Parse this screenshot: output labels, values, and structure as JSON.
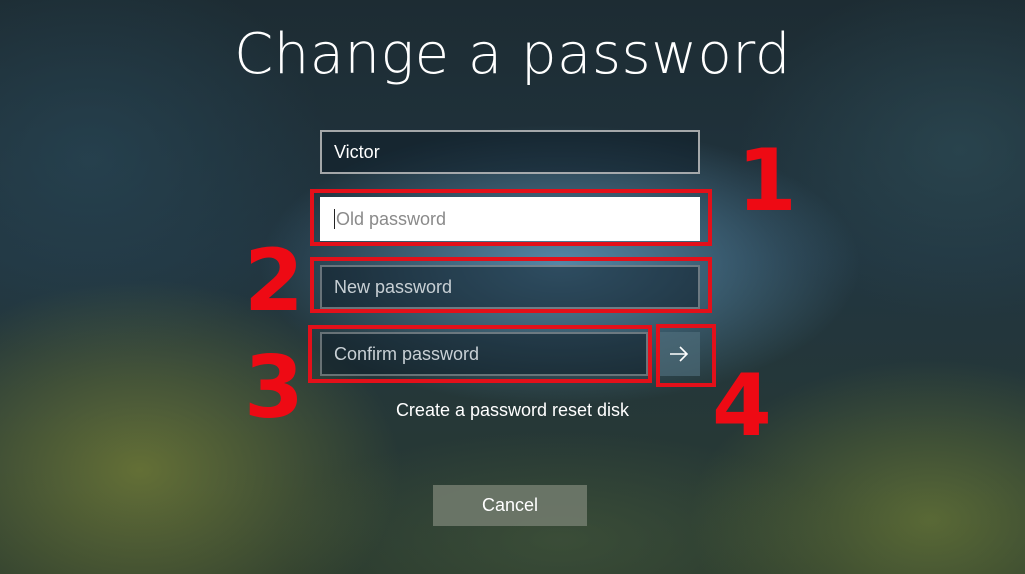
{
  "dialog": {
    "title": "Change a password",
    "username": "Victor",
    "old_password_placeholder": "Old password",
    "new_password_placeholder": "New password",
    "confirm_password_placeholder": "Confirm password",
    "reset_disk_link": "Create a password reset disk",
    "cancel_label": "Cancel",
    "submit_icon": "arrow-right-icon"
  },
  "annotations": {
    "color": "#e3101a",
    "labels": [
      "1",
      "2",
      "3",
      "4"
    ]
  }
}
